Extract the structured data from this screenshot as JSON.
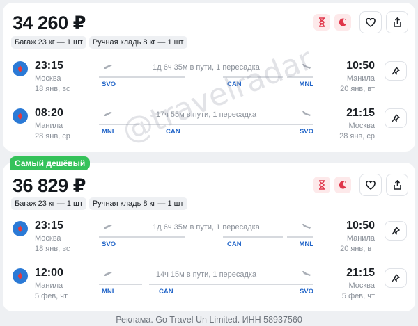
{
  "offers": [
    {
      "price": "34 260 ₽",
      "cheapest_label": "",
      "baggage": "Багаж 23 кг — 1 шт",
      "hand_luggage": "Ручная кладь 8 кг — 1 шт",
      "segments": [
        {
          "dep_time": "23:15",
          "dep_city": "Москва",
          "dep_date": "18 янв, вс",
          "arr_time": "10:50",
          "arr_city": "Манила",
          "arr_date": "20 янв, вт",
          "duration": "1д 6ч 35м в пути, 1 пересадка",
          "codes": [
            "SVO",
            "CAN",
            "MNL"
          ]
        },
        {
          "dep_time": "08:20",
          "dep_city": "Манила",
          "dep_date": "28 янв, ср",
          "arr_time": "21:15",
          "arr_city": "Москва",
          "arr_date": "28 янв, ср",
          "duration": "17ч 55м в пути, 1 пересадка",
          "codes": [
            "MNL",
            "CAN",
            "SVO"
          ]
        }
      ]
    },
    {
      "price": "36 829 ₽",
      "cheapest_label": "Самый дешёвый",
      "baggage": "Багаж 23 кг — 1 шт",
      "hand_luggage": "Ручная кладь 8 кг — 1 шт",
      "segments": [
        {
          "dep_time": "23:15",
          "dep_city": "Москва",
          "dep_date": "18 янв, вс",
          "arr_time": "10:50",
          "arr_city": "Манила",
          "arr_date": "20 янв, вт",
          "duration": "1д 6ч 35м в пути, 1 пересадка",
          "codes": [
            "SVO",
            "CAN",
            "MNL"
          ]
        },
        {
          "dep_time": "12:00",
          "dep_city": "Манила",
          "dep_date": "5 фев, чт",
          "arr_time": "21:15",
          "arr_city": "Москва",
          "arr_date": "5 фев, чт",
          "duration": "14ч 15м в пути, 1 пересадка",
          "codes": [
            "MNL",
            "CAN",
            "SVO"
          ]
        }
      ]
    }
  ],
  "watermark": "@travelradar",
  "footer": "Реклама. Go Travel Un Limited. ИНН 58937560",
  "icons": {
    "hourglass": "hourglass-icon",
    "night": "moon-icon",
    "favorite": "heart-icon",
    "share": "share-icon",
    "pin": "pin-icon",
    "airline": "china-southern-logo"
  },
  "colors": {
    "accent": "#2366c9",
    "cheapest": "#35c25a",
    "badge_bg": "#fde9ea",
    "badge_icon": "#e0364a"
  }
}
